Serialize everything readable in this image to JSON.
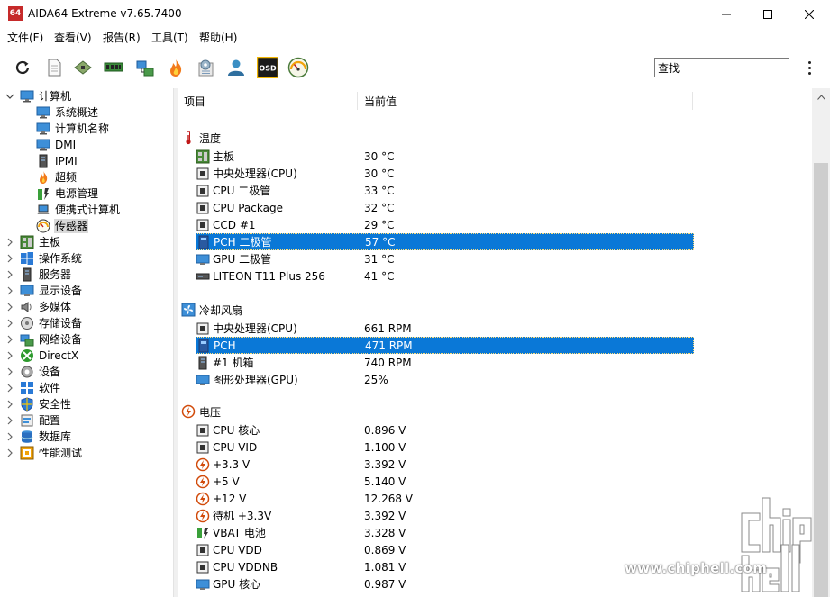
{
  "window": {
    "app_icon_text": "64",
    "title": "AIDA64 Extreme v7.65.7400"
  },
  "menu": [
    "文件(F)",
    "查看(V)",
    "报告(R)",
    "工具(T)",
    "帮助(H)"
  ],
  "toolbar": {
    "search_value": "查找",
    "icons": [
      "refresh-icon",
      "report-icon",
      "motherboard-icon",
      "memory-icon",
      "network-icon",
      "flame-icon",
      "settings-icon",
      "user-icon",
      "osd-icon",
      "gauge-icon"
    ],
    "osd_label": "OSD"
  },
  "tree": {
    "root_label": "计算机",
    "children": [
      "系统概述",
      "计算机名称",
      "DMI",
      "IPMI",
      "超频",
      "电源管理",
      "便携式计算机",
      "传感器"
    ],
    "selected": "传感器",
    "top_nodes": [
      "主板",
      "操作系统",
      "服务器",
      "显示设备",
      "多媒体",
      "存储设备",
      "网络设备",
      "DirectX",
      "设备",
      "软件",
      "安全性",
      "配置",
      "数据库",
      "性能测试"
    ]
  },
  "list": {
    "columns": [
      "项目",
      "当前值"
    ],
    "groups": [
      {
        "title": "温度",
        "rows": [
          {
            "label": "主板",
            "value": "30 °C"
          },
          {
            "label": "中央处理器(CPU)",
            "value": "30 °C"
          },
          {
            "label": "CPU 二极管",
            "value": "33 °C"
          },
          {
            "label": "CPU Package",
            "value": "32 °C"
          },
          {
            "label": "CCD #1",
            "value": "29 °C"
          },
          {
            "label": "PCH 二极管",
            "value": "57 °C",
            "selected": true
          },
          {
            "label": "GPU 二极管",
            "value": "31 °C"
          },
          {
            "label": "LITEON T11 Plus 256",
            "value": "41 °C"
          }
        ]
      },
      {
        "title": "冷却风扇",
        "rows": [
          {
            "label": "中央处理器(CPU)",
            "value": "661 RPM"
          },
          {
            "label": "PCH",
            "value": "471 RPM",
            "selected": true
          },
          {
            "label": "#1 机箱",
            "value": "740 RPM"
          },
          {
            "label": "图形处理器(GPU)",
            "value": "25%"
          }
        ]
      },
      {
        "title": "电压",
        "rows": [
          {
            "label": "CPU 核心",
            "value": "0.896 V"
          },
          {
            "label": "CPU VID",
            "value": "1.100 V"
          },
          {
            "label": "+3.3 V",
            "value": "3.392 V"
          },
          {
            "label": "+5 V",
            "value": "5.140 V"
          },
          {
            "label": "+12 V",
            "value": "12.268 V"
          },
          {
            "label": "待机 +3.3V",
            "value": "3.392 V"
          },
          {
            "label": "VBAT 电池",
            "value": "3.328 V"
          },
          {
            "label": "CPU VDD",
            "value": "0.869 V"
          },
          {
            "label": "CPU VDDNB",
            "value": "1.081 V"
          },
          {
            "label": "GPU 核心",
            "value": "0.987 V"
          }
        ]
      }
    ]
  },
  "watermark": {
    "url": "www.chiphell.com"
  },
  "colors": {
    "selection": "#0a78d7",
    "tree_selection": "#d9d9d9"
  }
}
